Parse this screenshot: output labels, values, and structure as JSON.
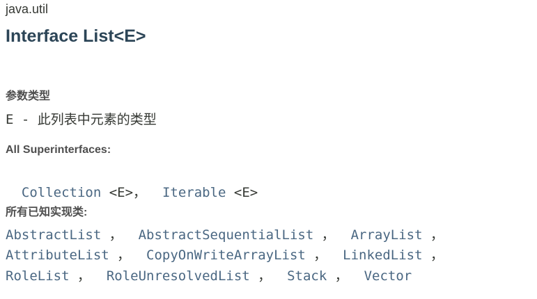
{
  "header": {
    "package": "java.util",
    "title": "Interface List<E>"
  },
  "params": {
    "heading": "参数类型",
    "name": "E",
    "dash": " - ",
    "description": "此列表中元素的类型"
  },
  "superinterfaces": {
    "heading": "All Superinterfaces:",
    "items": [
      {
        "name": "Collection",
        "type_arg": " <E>"
      },
      {
        "name": "Iterable",
        "type_arg": " <E>"
      }
    ],
    "separator": "，  "
  },
  "implementing": {
    "heading": "所有已知实现类:",
    "rows": [
      [
        "AbstractList",
        "AbstractSequentialList",
        "ArrayList"
      ],
      [
        "AttributeList",
        "CopyOnWriteArrayList",
        "LinkedList"
      ],
      [
        "RoleList",
        "RoleUnresolvedList",
        "Stack",
        "Vector"
      ]
    ],
    "separator": " ，  ",
    "trailing": " ，"
  }
}
